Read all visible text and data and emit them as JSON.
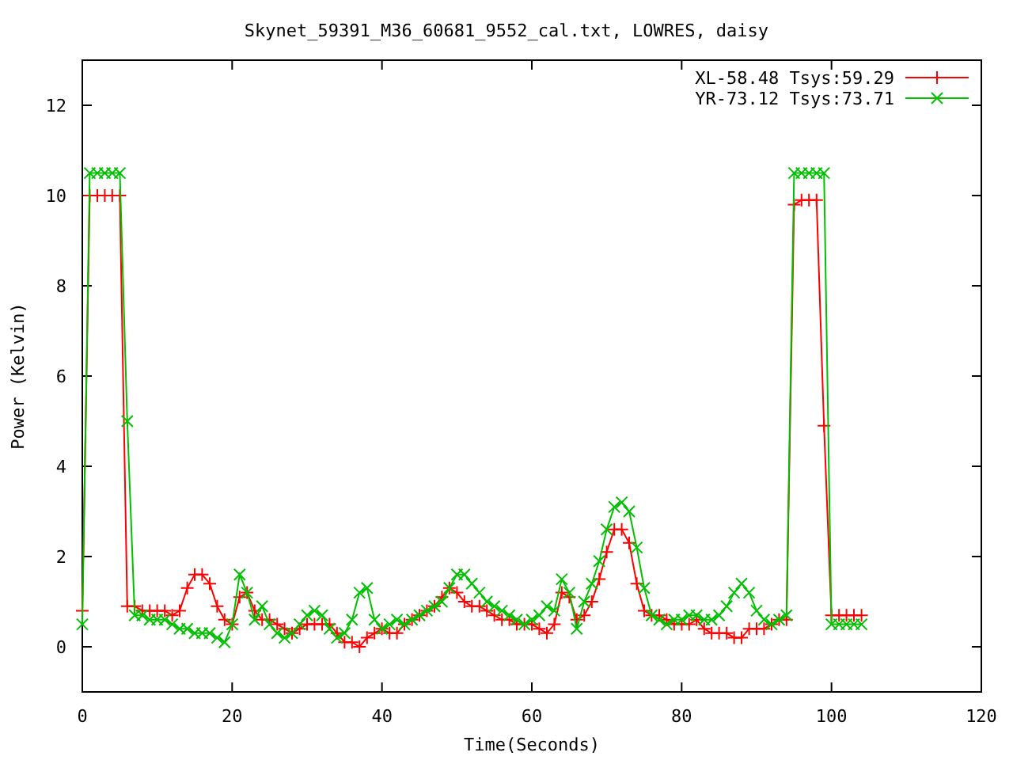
{
  "chart_data": {
    "type": "line",
    "title": "Skynet_59391_M36_60681_9552_cal.txt, LOWRES, daisy",
    "xlabel": "Time(Seconds)",
    "ylabel": "Power (Kelvin)",
    "legend": true,
    "xlim": [
      0,
      120
    ],
    "ylim": [
      -1,
      13
    ],
    "xticks": [
      0,
      20,
      40,
      60,
      80,
      100,
      120
    ],
    "yticks": [
      0,
      2,
      4,
      6,
      8,
      10,
      12
    ],
    "x": [
      0,
      1,
      2,
      3,
      4,
      5,
      6,
      7,
      8,
      9,
      10,
      11,
      12,
      13,
      14,
      15,
      16,
      17,
      18,
      19,
      20,
      21,
      22,
      23,
      24,
      25,
      26,
      27,
      28,
      29,
      30,
      31,
      32,
      33,
      34,
      35,
      36,
      37,
      38,
      39,
      40,
      41,
      42,
      43,
      44,
      45,
      46,
      47,
      48,
      49,
      50,
      51,
      52,
      53,
      54,
      55,
      56,
      57,
      58,
      59,
      60,
      61,
      62,
      63,
      64,
      65,
      66,
      67,
      68,
      69,
      70,
      71,
      72,
      73,
      74,
      75,
      76,
      77,
      78,
      79,
      80,
      81,
      82,
      83,
      84,
      85,
      86,
      87,
      88,
      89,
      90,
      91,
      92,
      93,
      94,
      95,
      96,
      97,
      98,
      99,
      100,
      101,
      102,
      103,
      104
    ],
    "series": [
      {
        "name": "XL-58.48 Tsys:59.29",
        "color": "#ff0000",
        "values": [
          0.8,
          10.0,
          10.0,
          10.0,
          10.0,
          10.0,
          0.9,
          0.9,
          0.8,
          0.8,
          0.8,
          0.8,
          0.7,
          0.8,
          1.3,
          1.6,
          1.6,
          1.4,
          0.9,
          0.6,
          0.5,
          1.1,
          1.2,
          0.8,
          0.6,
          0.6,
          0.5,
          0.4,
          0.3,
          0.4,
          0.5,
          0.5,
          0.5,
          0.5,
          0.3,
          0.1,
          0.1,
          0.0,
          0.2,
          0.3,
          0.4,
          0.3,
          0.3,
          0.5,
          0.6,
          0.7,
          0.8,
          0.9,
          1.1,
          1.3,
          1.2,
          1.0,
          0.9,
          0.9,
          0.8,
          0.7,
          0.6,
          0.6,
          0.5,
          0.5,
          0.5,
          0.4,
          0.3,
          0.5,
          1.2,
          1.1,
          0.6,
          0.7,
          1.0,
          1.5,
          2.1,
          2.6,
          2.6,
          2.3,
          1.4,
          0.8,
          0.7,
          0.7,
          0.6,
          0.5,
          0.5,
          0.5,
          0.6,
          0.4,
          0.3,
          0.3,
          0.3,
          0.2,
          0.2,
          0.4,
          0.4,
          0.4,
          0.5,
          0.6,
          0.6,
          9.8,
          9.9,
          9.9,
          9.9,
          4.9,
          0.7,
          0.7,
          0.7,
          0.7,
          0.7
        ]
      },
      {
        "name": "YR-73.12 Tsys:73.71",
        "color": "#00c000",
        "values": [
          0.5,
          10.5,
          10.5,
          10.5,
          10.5,
          10.5,
          5.0,
          0.7,
          0.7,
          0.6,
          0.6,
          0.6,
          0.5,
          0.4,
          0.4,
          0.3,
          0.3,
          0.3,
          0.2,
          0.1,
          0.5,
          1.6,
          1.2,
          0.6,
          0.9,
          0.5,
          0.3,
          0.2,
          0.3,
          0.5,
          0.7,
          0.8,
          0.7,
          0.4,
          0.2,
          0.3,
          0.6,
          1.2,
          1.3,
          0.6,
          0.4,
          0.5,
          0.6,
          0.5,
          0.6,
          0.7,
          0.8,
          0.9,
          1.0,
          1.3,
          1.6,
          1.6,
          1.4,
          1.2,
          1.0,
          0.9,
          0.8,
          0.7,
          0.6,
          0.5,
          0.6,
          0.7,
          0.9,
          0.8,
          1.5,
          1.2,
          0.4,
          1.0,
          1.4,
          1.9,
          2.6,
          3.1,
          3.2,
          3.0,
          2.2,
          1.3,
          0.7,
          0.6,
          0.5,
          0.6,
          0.6,
          0.7,
          0.7,
          0.6,
          0.6,
          0.7,
          0.9,
          1.2,
          1.4,
          1.2,
          0.8,
          0.6,
          0.5,
          0.6,
          0.7,
          10.5,
          10.5,
          10.5,
          10.5,
          10.5,
          0.5,
          0.5,
          0.5,
          0.5,
          0.5
        ]
      }
    ]
  }
}
